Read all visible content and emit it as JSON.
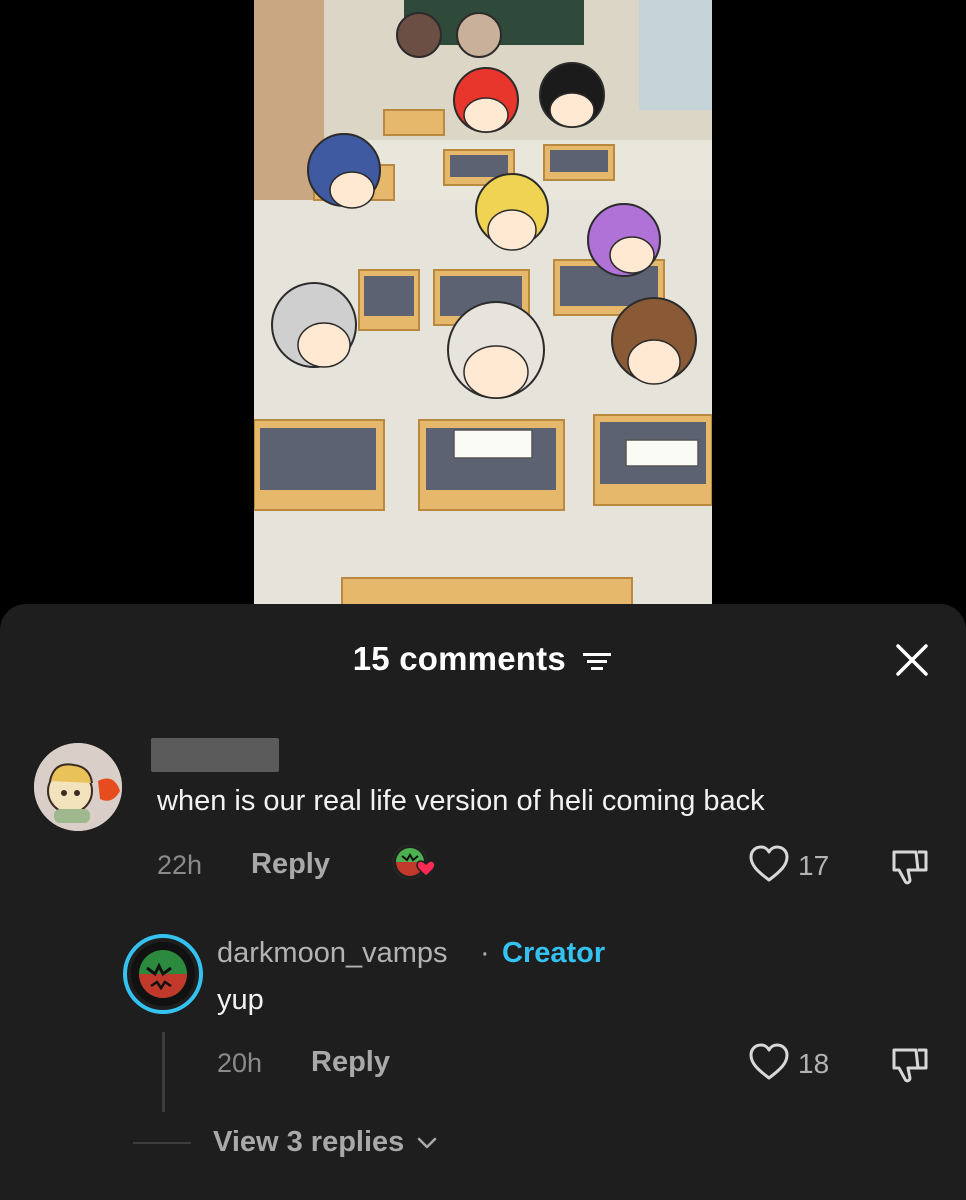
{
  "video": {
    "scene": "classroom-illustration"
  },
  "sheet": {
    "title": "15 comments",
    "sort_icon": "sort-lines-icon",
    "close_icon": "close-icon"
  },
  "comments": [
    {
      "username_redacted": true,
      "text": "when is our real life version of heli coming back",
      "time": "22h",
      "reply_label": "Reply",
      "liked_by_creator": true,
      "likes": "17",
      "like_icon": "heart-outline-icon",
      "dislike_icon": "thumbs-down-icon",
      "replies": [
        {
          "username": "darkmoon_vamps",
          "separator": "·",
          "badge": "Creator",
          "text": "yup",
          "time": "20h",
          "reply_label": "Reply",
          "likes": "18"
        }
      ],
      "view_replies_label": "View 3 replies"
    }
  ],
  "colors": {
    "sheet_bg": "#1e1e1e",
    "creator_accent": "#34c3f0",
    "meta_text": "#8a8a8a",
    "heart_red": "#fe2c55"
  }
}
